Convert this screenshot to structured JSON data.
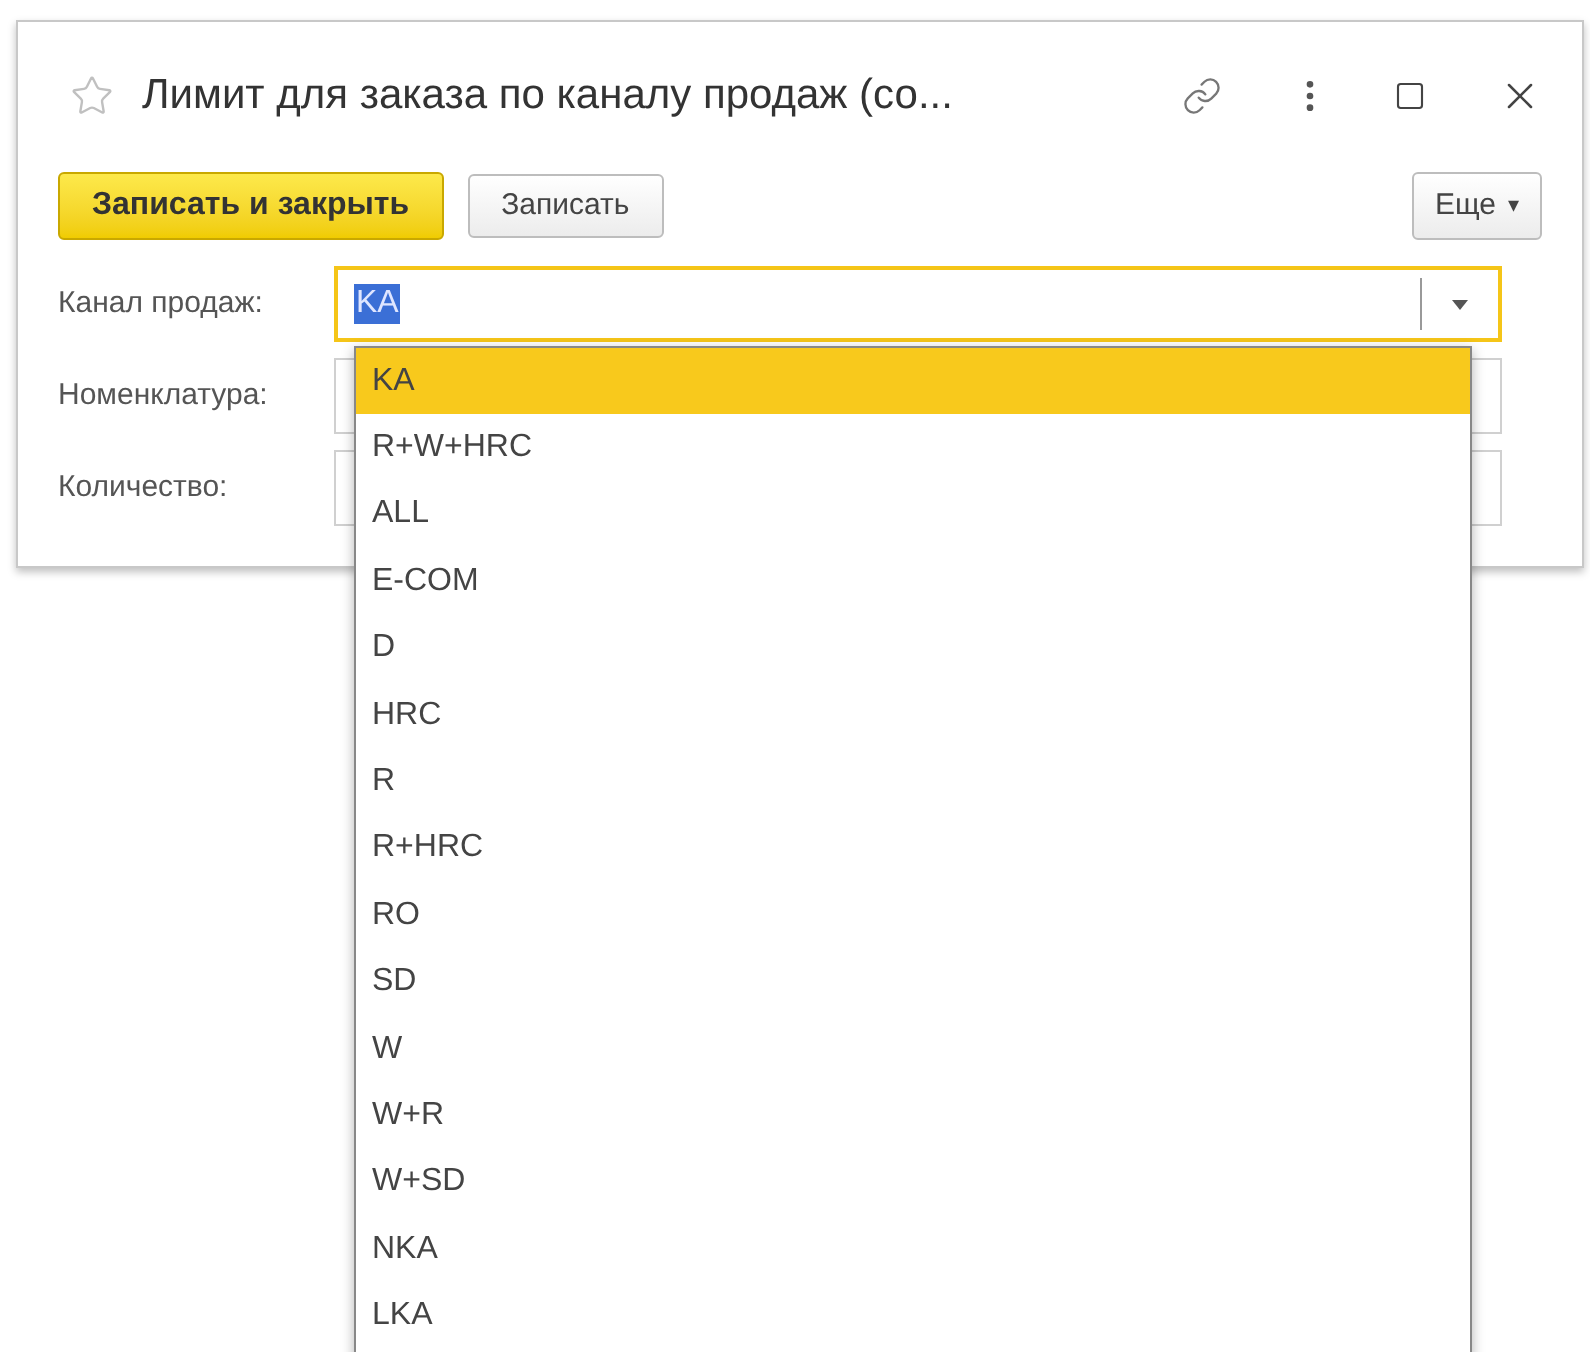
{
  "window": {
    "title": "Лимит для заказа по каналу продаж (со..."
  },
  "toolbar": {
    "buttons": [
      {
        "label": "Записать и закрыть",
        "kind": "primary"
      },
      {
        "label": "Записать",
        "kind": "plain"
      }
    ],
    "more": {
      "label": "Еще",
      "caret": "▾"
    }
  },
  "fields": [
    {
      "label": "Канал продаж:",
      "value": "KA",
      "focused": true
    },
    {
      "label": "Номенклатура:",
      "focused": false
    },
    {
      "label": "Количество:",
      "focused": false
    }
  ],
  "dropdown": {
    "items": [
      {
        "label": "KA",
        "selected": true
      },
      {
        "label": "R+W+HRC",
        "selected": false
      },
      {
        "label": "ALL",
        "selected": false
      },
      {
        "label": "E-COM",
        "selected": false
      },
      {
        "label": "D",
        "selected": false
      },
      {
        "label": "HRC",
        "selected": false
      },
      {
        "label": "R",
        "selected": false
      },
      {
        "label": "R+HRC",
        "selected": false
      },
      {
        "label": "RO",
        "selected": false
      },
      {
        "label": "SD",
        "selected": false
      },
      {
        "label": "W",
        "selected": false
      },
      {
        "label": "W+R",
        "selected": false
      },
      {
        "label": "W+SD",
        "selected": false
      },
      {
        "label": "NKA",
        "selected": false
      },
      {
        "label": "LKA",
        "selected": false
      }
    ]
  }
}
